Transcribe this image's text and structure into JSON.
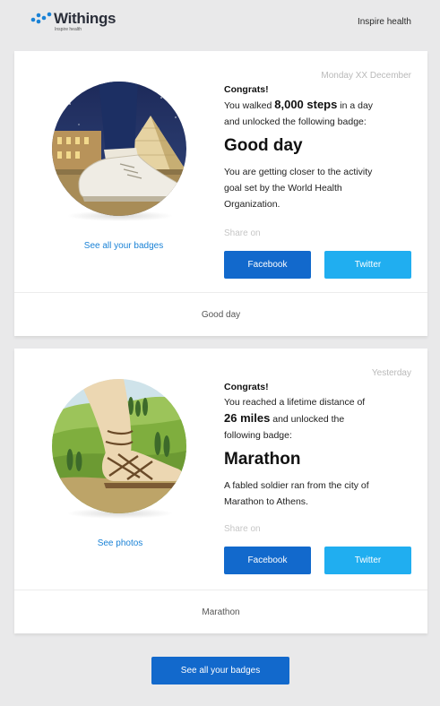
{
  "header": {
    "logo_text": "Withings",
    "logo_tagline": "Inspire health",
    "tagline": "Inspire health",
    "brand_color": "#1a82d6"
  },
  "cards": [
    {
      "date": "Monday XX December",
      "congrats": "Congrats!",
      "line1_pre": "You walked ",
      "line1_bold": "8,000 steps",
      "line1_post": " in a day",
      "line2": "and unlocked the following badge:",
      "badge_name": "Good day",
      "desc1": "You are getting closer to the activity",
      "desc2": "goal set by the World Health",
      "desc3": "Organization.",
      "link": "See all your badges",
      "share_label": "Share on",
      "facebook": "Facebook",
      "twitter": "Twitter",
      "footer": "Good day"
    },
    {
      "date": "Yesterday",
      "congrats": "Congrats!",
      "line1": "You reached a lifetime distance of",
      "line2_bold": "26 miles",
      "line2_post": " and unlocked the",
      "line3": "following badge:",
      "badge_name": "Marathon",
      "desc1": "A fabled soldier ran from the city of",
      "desc2": "Marathon to Athens.",
      "link": "See photos",
      "share_label": "Share on",
      "facebook": "Facebook",
      "twitter": "Twitter",
      "footer": "Marathon"
    }
  ],
  "bottom_button": "See all your badges",
  "colors": {
    "facebook": "#1269cc",
    "twitter": "#20aef0",
    "link": "#1a82d6",
    "background": "#e9e9ea"
  },
  "icons": [
    "withings-logo-icon",
    "good-day-badge-illustration",
    "marathon-badge-illustration"
  ]
}
